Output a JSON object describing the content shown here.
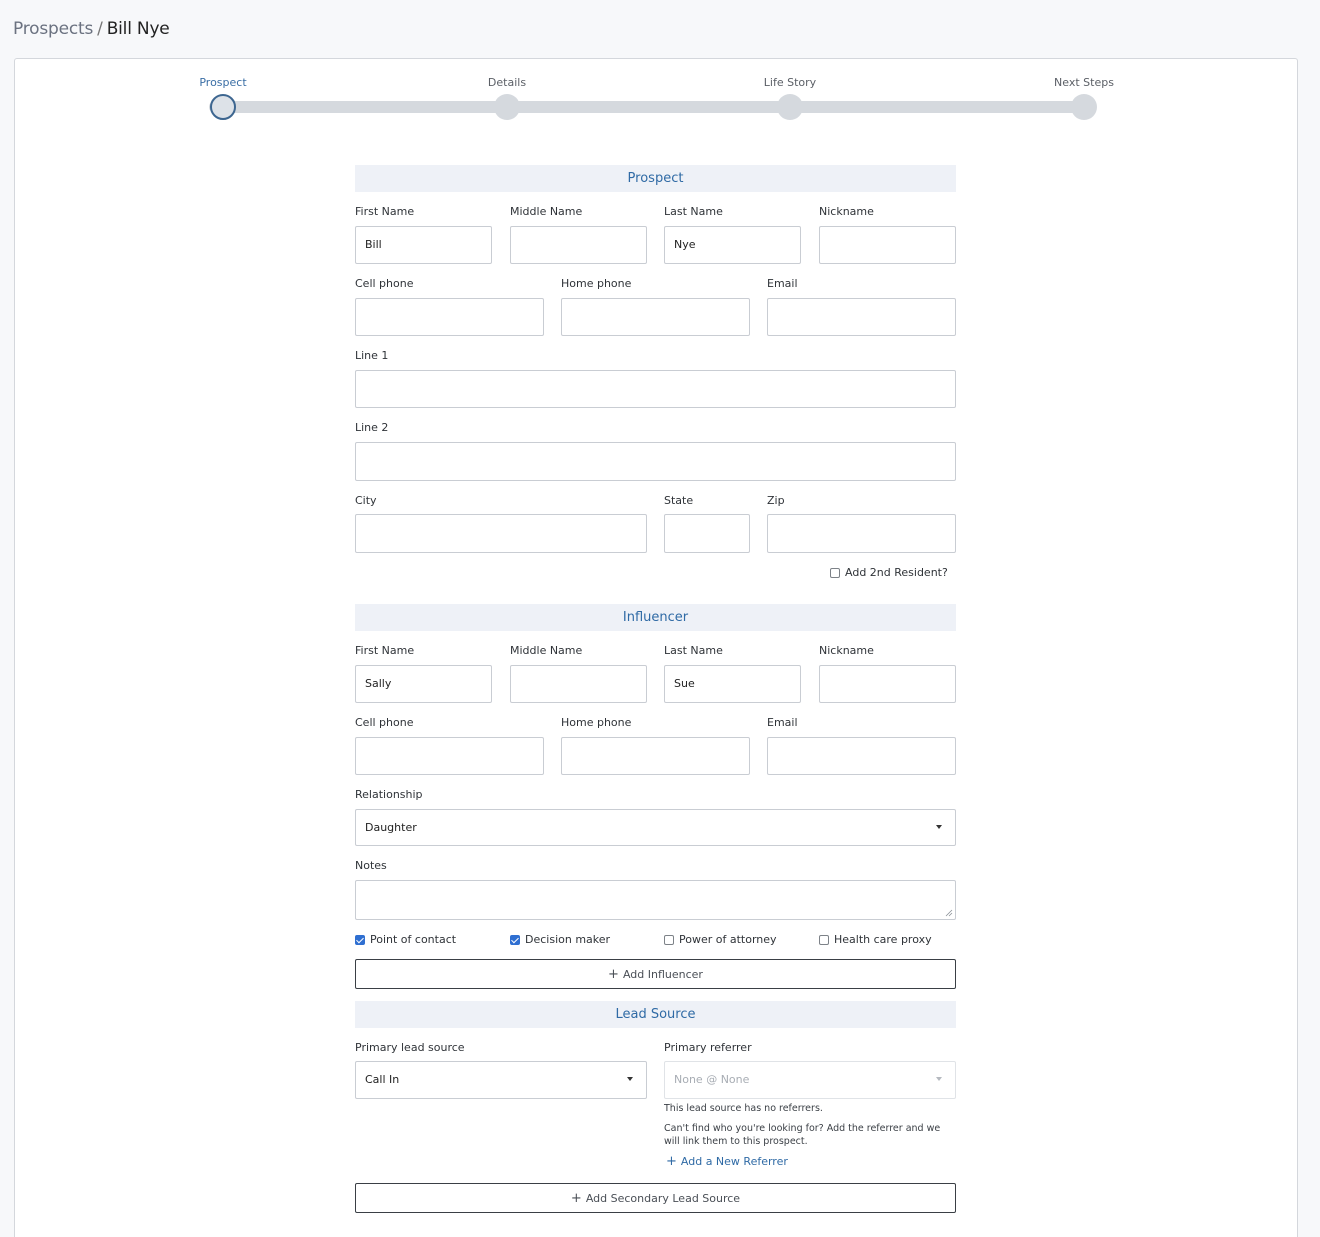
{
  "breadcrumb": {
    "parent": "Prospects",
    "separator": "/",
    "current": "Bill Nye"
  },
  "stepper": {
    "steps": [
      {
        "label": "Prospect",
        "active": true
      },
      {
        "label": "Details",
        "active": false
      },
      {
        "label": "Life Story",
        "active": false
      },
      {
        "label": "Next Steps",
        "active": false
      }
    ]
  },
  "prospect": {
    "heading": "Prospect",
    "first_name_label": "First Name",
    "first_name": "Bill",
    "middle_name_label": "Middle Name",
    "middle_name": "",
    "last_name_label": "Last Name",
    "last_name": "Nye",
    "nickname_label": "Nickname",
    "nickname": "",
    "cell_phone_label": "Cell phone",
    "cell_phone": "",
    "home_phone_label": "Home phone",
    "home_phone": "",
    "email_label": "Email",
    "email": "",
    "line1_label": "Line 1",
    "line1": "",
    "line2_label": "Line 2",
    "line2": "",
    "city_label": "City",
    "city": "",
    "state_label": "State",
    "state": "",
    "zip_label": "Zip",
    "zip": "",
    "add_second_resident_label": "Add 2nd Resident?",
    "add_second_resident_checked": false
  },
  "influencer": {
    "heading": "Influencer",
    "first_name_label": "First Name",
    "first_name": "Sally",
    "middle_name_label": "Middle Name",
    "middle_name": "",
    "last_name_label": "Last Name",
    "last_name": "Sue",
    "nickname_label": "Nickname",
    "nickname": "",
    "cell_phone_label": "Cell phone",
    "cell_phone": "",
    "home_phone_label": "Home phone",
    "home_phone": "",
    "email_label": "Email",
    "email": "",
    "relationship_label": "Relationship",
    "relationship": "Daughter",
    "notes_label": "Notes",
    "notes": "",
    "roles": [
      {
        "label": "Point of contact",
        "checked": true
      },
      {
        "label": "Decision maker",
        "checked": true
      },
      {
        "label": "Power of attorney",
        "checked": false
      },
      {
        "label": "Health care proxy",
        "checked": false
      }
    ],
    "add_button_label": "Add Influencer"
  },
  "lead_source": {
    "heading": "Lead Source",
    "primary_label": "Primary lead source",
    "primary_value": "Call In",
    "referrer_label": "Primary referrer",
    "referrer_value": "None @ None",
    "no_referrers_text": "This lead source has no referrers.",
    "cant_find_text": "Can't find who you're looking for? Add the referrer and we will link them to this prospect.",
    "add_referrer_label": "Add a New Referrer",
    "add_secondary_label": "Add Secondary Lead Source"
  }
}
